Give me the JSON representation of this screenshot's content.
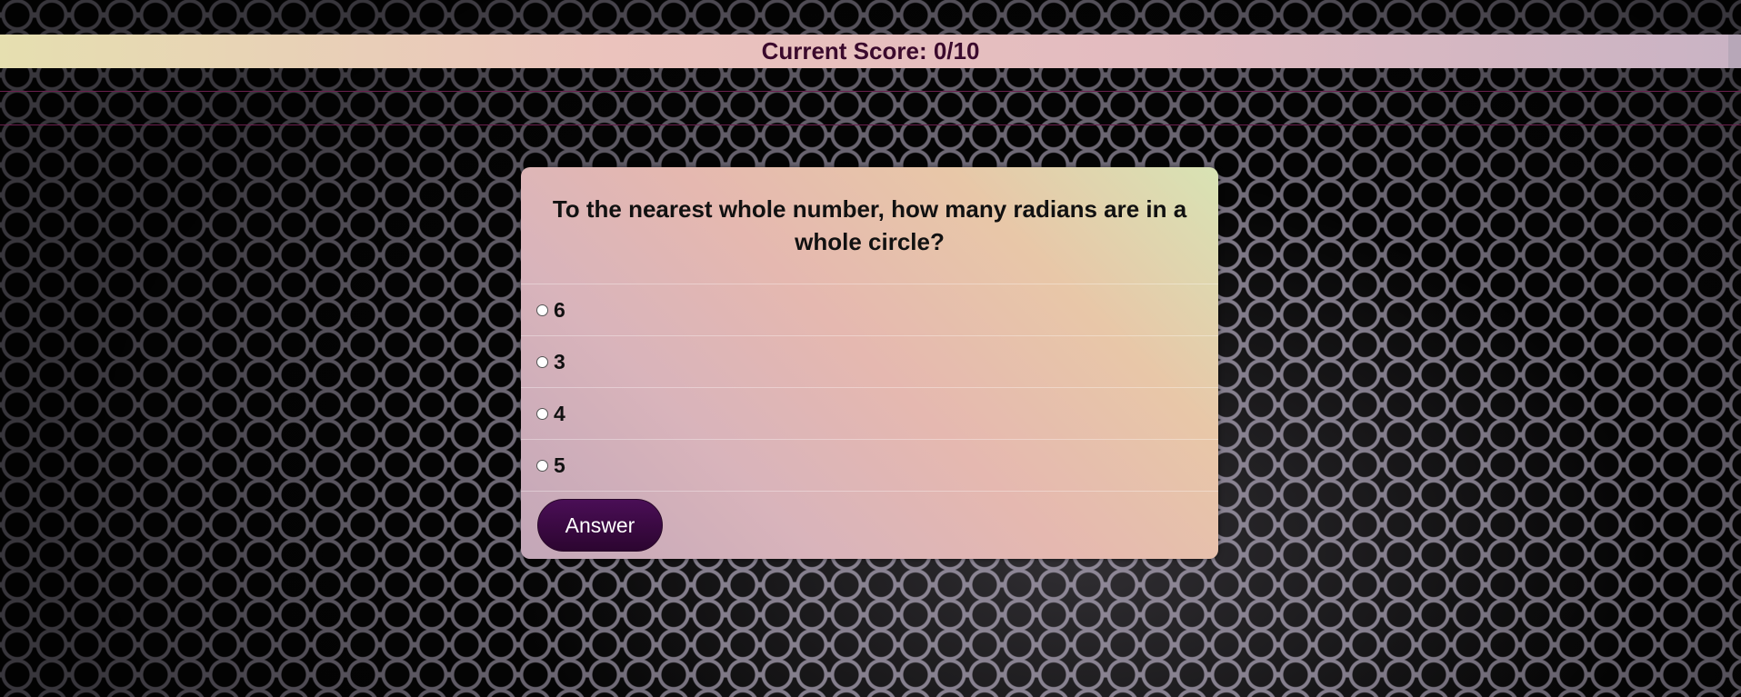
{
  "score_bar": {
    "text": "Current Score: 0/10"
  },
  "quiz": {
    "question": "To the nearest whole number, how many radians are in a whole circle?",
    "options": [
      {
        "label": "6"
      },
      {
        "label": "3"
      },
      {
        "label": "4"
      },
      {
        "label": "5"
      }
    ],
    "answer_button_label": "Answer"
  },
  "colors": {
    "score_text": "#3b0a2d",
    "answer_button": "#3a0a42"
  }
}
